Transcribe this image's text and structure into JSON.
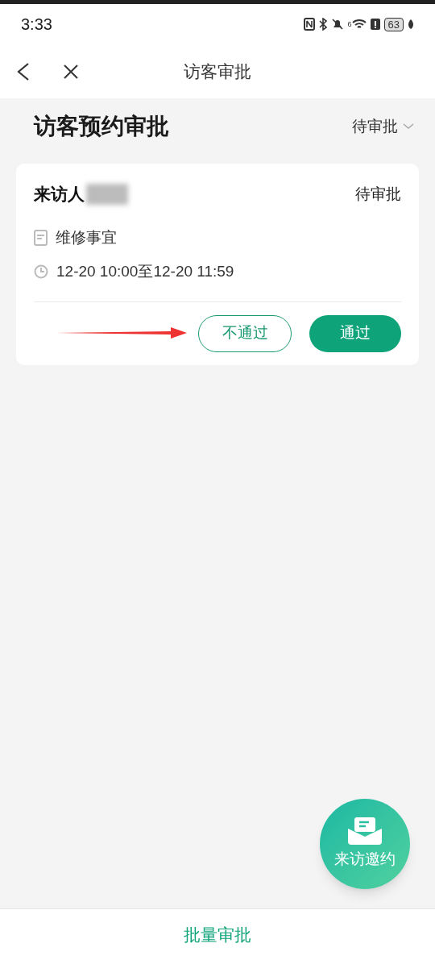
{
  "status_bar": {
    "time": "3:33",
    "wifi_label": "6",
    "battery": "63"
  },
  "nav": {
    "title": "访客审批"
  },
  "header": {
    "title": "访客预约审批",
    "filter": "待审批"
  },
  "cards": [
    {
      "visitor_label": "来访人",
      "status": "待审批",
      "purpose": "维修事宜",
      "time": "12-20 10:00至12-20 11:59",
      "reject": "不通过",
      "approve": "通过"
    }
  ],
  "fab": {
    "label": "来访邀约"
  },
  "bottom": {
    "label": "批量审批"
  }
}
